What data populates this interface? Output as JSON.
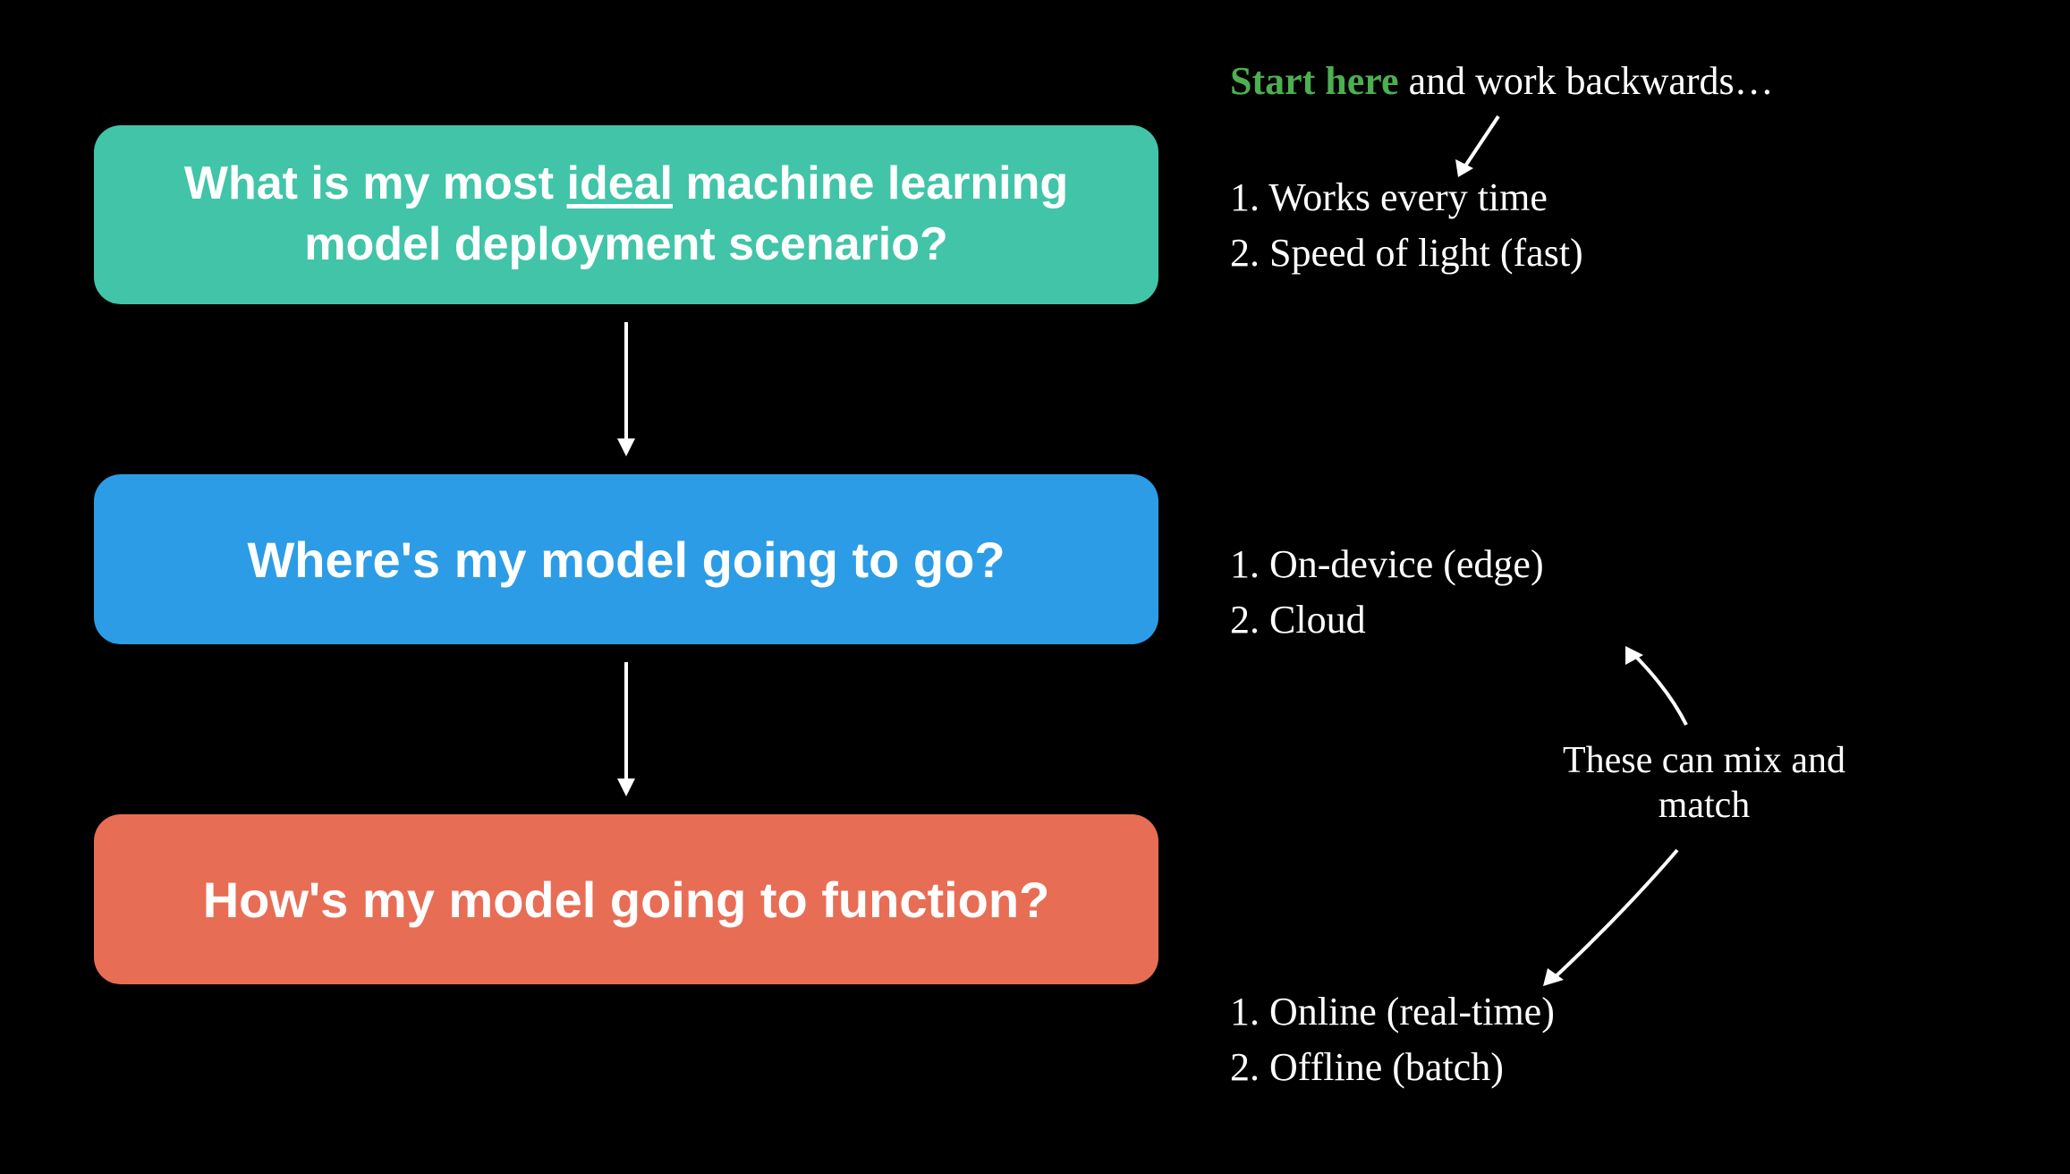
{
  "blocks": {
    "teal": {
      "prefix": "What is my most ",
      "underlined": "ideal",
      "suffix": " machine learning model deployment scenario?"
    },
    "blue": "Where's my model going to go?",
    "red": "How's my model going to function?"
  },
  "annotations": {
    "start_here": "Start here",
    "work_backwards": " and work backwards…",
    "mix_match": "These can mix and match"
  },
  "lists": {
    "top": {
      "item1": "1. Works every time",
      "item2": "2. Speed of light (fast)"
    },
    "middle": {
      "item1": "1. On-device (edge)",
      "item2": "2. Cloud"
    },
    "bottom": {
      "item1": "1. Online (real-time)",
      "item2": "2. Offline (batch)"
    }
  },
  "colors": {
    "teal": "#42c4a8",
    "blue": "#2c9ce6",
    "red": "#e86d55",
    "green_text": "#4caf50",
    "background": "#000000"
  }
}
